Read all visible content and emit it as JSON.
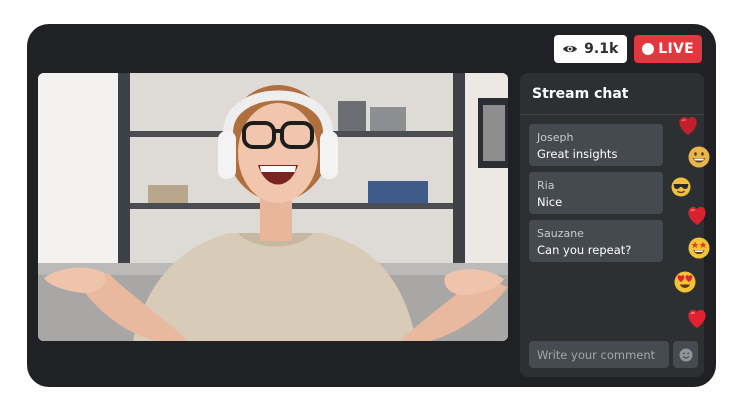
{
  "header": {
    "viewer_count": "9.1k",
    "live_label": "LIVE"
  },
  "chat": {
    "title": "Stream chat",
    "messages": [
      {
        "name": "Joseph",
        "text": "Great insights"
      },
      {
        "name": "Ria",
        "text": "Nice"
      },
      {
        "name": "Sauzane",
        "text": "Can you repeat?"
      }
    ],
    "comment_placeholder": "Write your comment"
  },
  "reactions": [
    "heart",
    "grinning-face",
    "sunglasses-face",
    "heart",
    "star-struck-face",
    "heart-eyes-face",
    "heart"
  ],
  "colors": {
    "app_bg": "#1f2124",
    "panel_bg": "#2d3033",
    "bubble_bg": "#444a4f",
    "live_red": "#e0383e",
    "heart_red": "#d8232f"
  }
}
